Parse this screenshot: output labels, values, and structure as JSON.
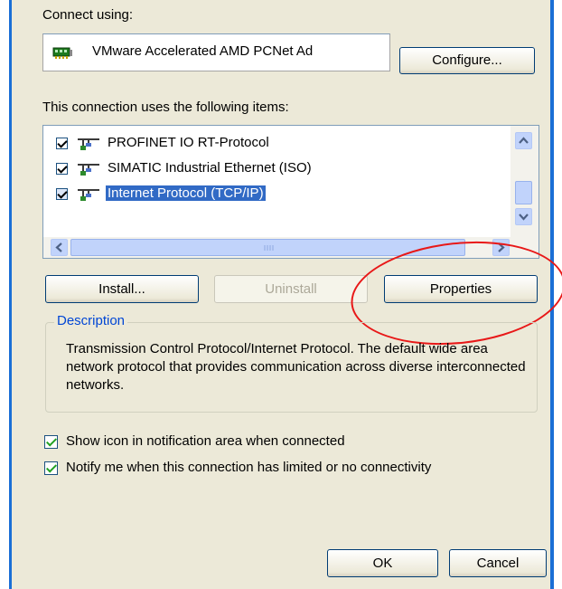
{
  "connect_using_label": "Connect using:",
  "adapter": {
    "name": "VMware Accelerated AMD PCNet Ad",
    "icon": "network-card-icon"
  },
  "buttons": {
    "configure": "Configure...",
    "install": "Install...",
    "uninstall": "Uninstall",
    "properties": "Properties",
    "ok": "OK",
    "cancel": "Cancel"
  },
  "items_label": "This connection uses the following items:",
  "items": [
    {
      "label": "PROFINET IO RT-Protocol",
      "checked": true,
      "selected": false
    },
    {
      "label": "SIMATIC Industrial Ethernet (ISO)",
      "checked": true,
      "selected": false
    },
    {
      "label": "Internet Protocol (TCP/IP)",
      "checked": true,
      "selected": true
    }
  ],
  "description": {
    "title": "Description",
    "text": "Transmission Control Protocol/Internet Protocol. The default wide area network protocol that provides communication across diverse interconnected networks."
  },
  "options": {
    "show_icon": "Show icon in notification area when connected",
    "notify": "Notify me when this connection has limited or no connectivity"
  },
  "colors": {
    "selection": "#316ac5",
    "annotation": "#e81818",
    "window_border": "#1a6fd6"
  }
}
